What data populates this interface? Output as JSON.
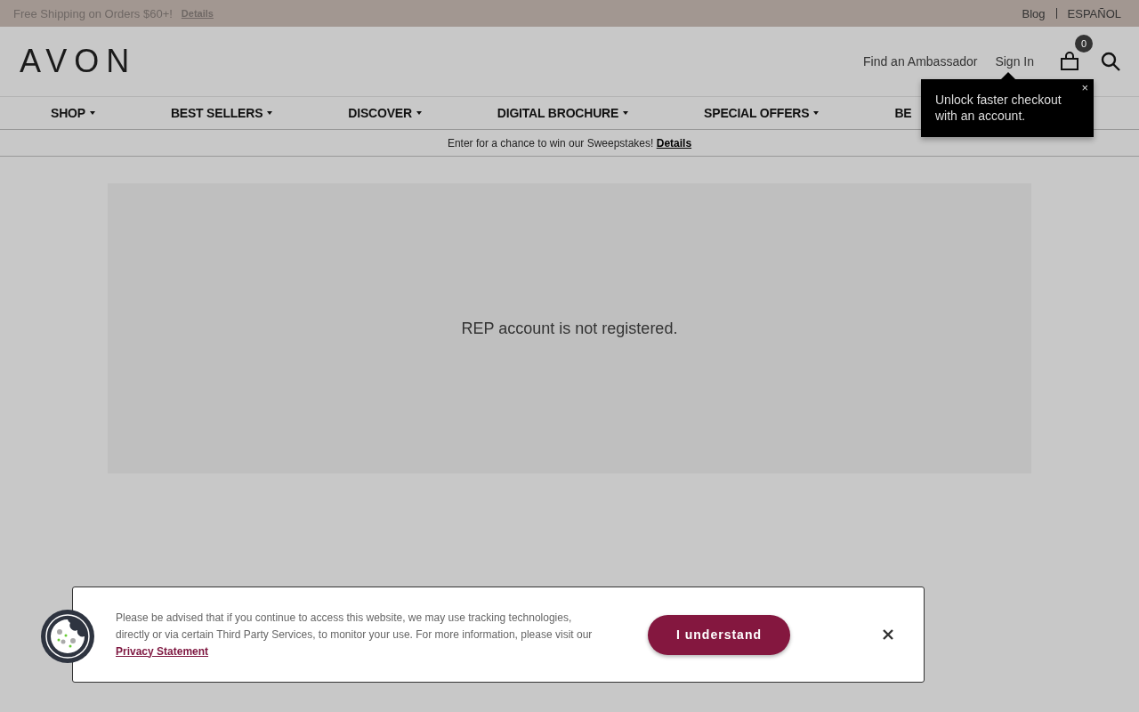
{
  "top_bar": {
    "promo": "Free Shipping on Orders $60+!",
    "promo_link": "Details",
    "links": [
      "Blog",
      "ESPAÑOL"
    ]
  },
  "header": {
    "logo": "AVON",
    "links": [
      "Find an Ambassador",
      "Sign In"
    ],
    "cart_count": "0"
  },
  "nav": [
    {
      "label": "SHOP",
      "dropdown": true
    },
    {
      "label": "BEST SELLERS",
      "dropdown": true
    },
    {
      "label": "DISCOVER",
      "dropdown": true
    },
    {
      "label": "DIGITAL BROCHURE",
      "dropdown": true
    },
    {
      "label": "SPECIAL OFFERS",
      "dropdown": true
    },
    {
      "label": "BE",
      "dropdown": false
    }
  ],
  "tooltip": {
    "text": "Unlock faster checkout with an account.",
    "close": "×"
  },
  "announcement": {
    "text": "Enter for a chance to win our Sweepstakes!",
    "link": "Details"
  },
  "message": "REP account is not registered.",
  "cookie_banner": {
    "text": "Please be advised that if you continue to access this website, we may use tracking technologies, directly or via certain Third Party Services, to monitor your use. For more information, please visit our",
    "link": "Privacy Statement",
    "button": "I understand"
  }
}
